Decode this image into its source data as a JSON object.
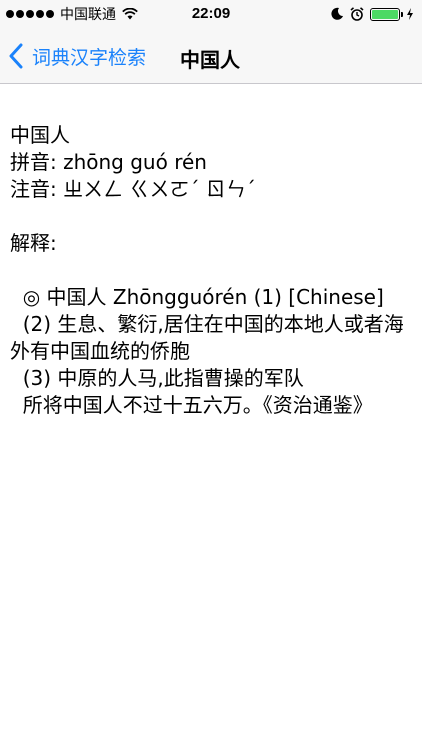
{
  "status": {
    "carrier": "中国联通",
    "time": "22:09",
    "signal_filled": 5
  },
  "nav": {
    "back_label": "词典汉字检索",
    "title": "中国人"
  },
  "content": {
    "word": "中国人",
    "pinyin": "拼音: zhōng guó rén",
    "zhuyin": "注音: ㄓㄨㄥ ㄍㄨㄛˊ ㄖㄣˊ",
    "explain_header": "解释:",
    "def1": "  ◎ 中国人 Zhōngguórén (1) [Chinese]",
    "def2": "  (2) 生息、繁衍,居住在中国的本地人或者海外有中国血统的侨胞",
    "def3": "  (3) 中原的人马,此指曹操的军队",
    "quote": "  所将中国人不过十五六万。《资治通鉴》"
  },
  "colors": {
    "accent": "#1a82fb",
    "battery": "#4cd964",
    "bar_bg": "#f7f7f7"
  }
}
